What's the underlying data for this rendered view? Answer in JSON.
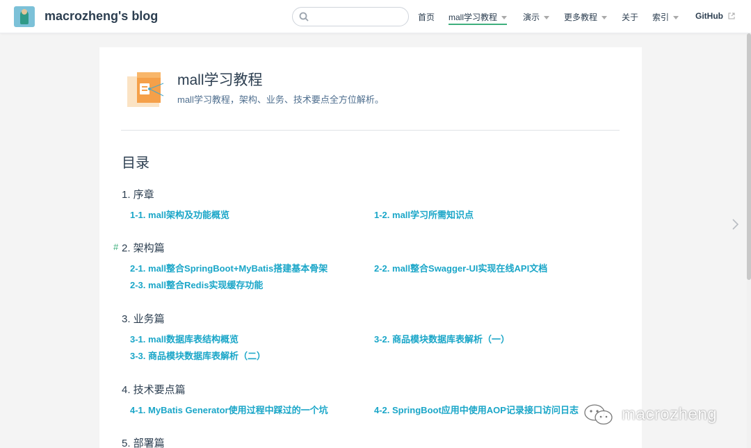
{
  "site": {
    "name": "macrozheng's blog"
  },
  "search": {
    "placeholder": ""
  },
  "nav": {
    "items": [
      {
        "label": "首页",
        "dropdown": false
      },
      {
        "label": "mall学习教程",
        "dropdown": true,
        "active": true
      },
      {
        "label": "演示",
        "dropdown": true
      },
      {
        "label": "更多教程",
        "dropdown": true
      },
      {
        "label": "关于",
        "dropdown": false
      },
      {
        "label": "索引",
        "dropdown": true
      },
      {
        "label": "GitHub",
        "dropdown": false,
        "external": true
      }
    ]
  },
  "page": {
    "title": "mall学习教程",
    "description": "mall学习教程，架构、业务、技术要点全方位解析。"
  },
  "toc": {
    "title": "目录",
    "anchor": "#",
    "sections": [
      {
        "title": "1. 序章",
        "links": [
          "1-1. mall架构及功能概览",
          "1-2. mall学习所需知识点"
        ]
      },
      {
        "title": "2. 架构篇",
        "links": [
          "2-1. mall整合SpringBoot+MyBatis搭建基本骨架",
          "2-2. mall整合Swagger-UI实现在线API文档",
          "2-3. mall整合Redis实现缓存功能"
        ]
      },
      {
        "title": "3. 业务篇",
        "links": [
          "3-1. mall数据库表结构概览",
          "3-2. 商品模块数据库表解析（一）",
          "3-3. 商品模块数据库表解析（二）"
        ]
      },
      {
        "title": "4. 技术要点篇",
        "links": [
          "4-1. MyBatis Generator使用过程中踩过的一个坑",
          "4-2. SpringBoot应用中使用AOP记录接口访问日志"
        ]
      },
      {
        "title": "5. 部署篇",
        "links": []
      }
    ]
  },
  "watermark": {
    "text": "macrozheng"
  },
  "colors": {
    "accent": "#3eaf7c",
    "link": "#1aa6c8",
    "text": "#2c3e50"
  }
}
